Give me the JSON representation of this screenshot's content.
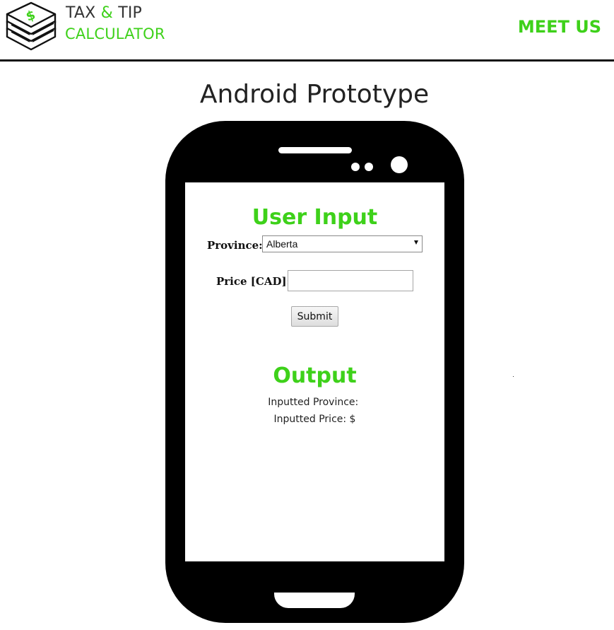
{
  "header": {
    "logo": {
      "line1_part1": "TAX ",
      "line1_amp": "&",
      "line1_part2": " TIP",
      "line2": "CALCULATOR",
      "icon": "money-stack-icon"
    },
    "nav_link": "MEET US"
  },
  "page_title": "Android Prototype",
  "form": {
    "title": "User Input",
    "province_label": "Province:",
    "province_value": "Alberta",
    "price_label": "Price [CAD]:",
    "price_value": "",
    "submit_label": "Submit"
  },
  "output": {
    "title": "Output",
    "province_line": "Inputted Province: ",
    "price_line": "Inputted Price: $"
  },
  "colors": {
    "accent": "#3ed11a",
    "phone": "#000000",
    "text": "#222222"
  }
}
